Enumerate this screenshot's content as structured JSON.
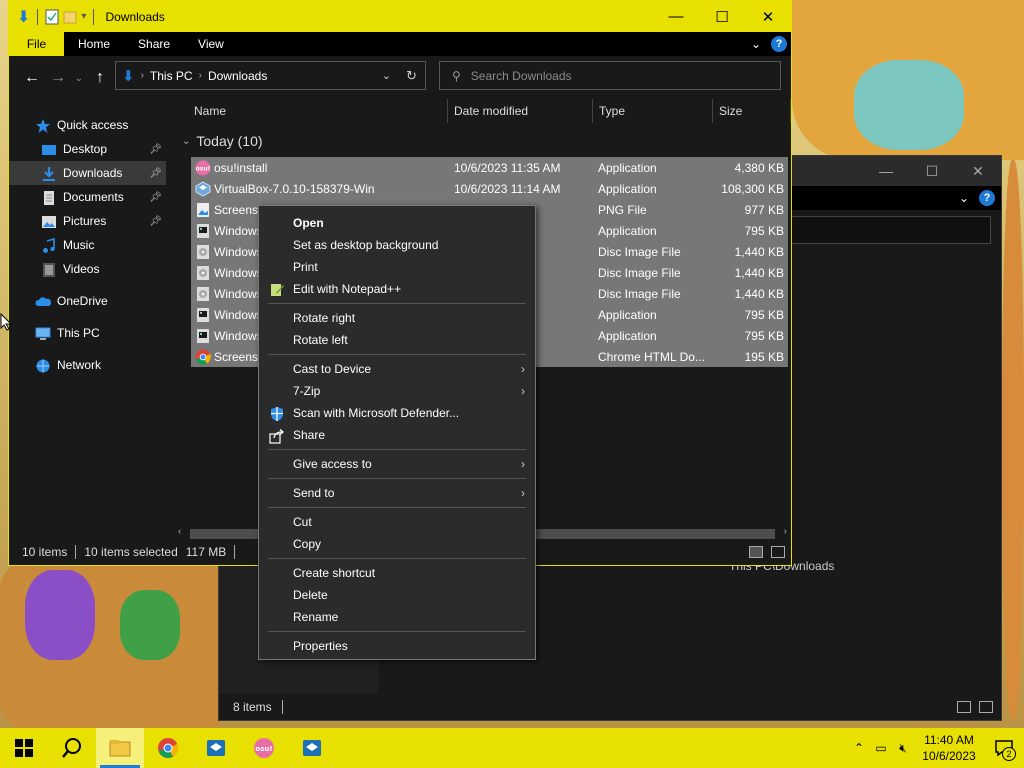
{
  "window": {
    "title": "Downloads",
    "ribbon_tabs": [
      "File",
      "Home",
      "Share",
      "View"
    ]
  },
  "address": {
    "crumbs": [
      "This PC",
      "Downloads"
    ]
  },
  "search": {
    "placeholder": "Search Downloads"
  },
  "sidebar": {
    "items": [
      {
        "label": "Quick access",
        "icon": "star-icon",
        "pinned": false
      },
      {
        "label": "Desktop",
        "icon": "desktop-folder-icon",
        "pinned": true
      },
      {
        "label": "Downloads",
        "icon": "download-folder-icon",
        "pinned": true
      },
      {
        "label": "Documents",
        "icon": "documents-folder-icon",
        "pinned": true
      },
      {
        "label": "Pictures",
        "icon": "pictures-folder-icon",
        "pinned": true
      },
      {
        "label": "Music",
        "icon": "music-folder-icon",
        "pinned": false
      },
      {
        "label": "Videos",
        "icon": "videos-folder-icon",
        "pinned": false
      },
      {
        "label": "OneDrive",
        "icon": "onedrive-icon",
        "pinned": false
      },
      {
        "label": "This PC",
        "icon": "computer-icon",
        "pinned": false
      },
      {
        "label": "Network",
        "icon": "network-icon",
        "pinned": false
      }
    ]
  },
  "columns": {
    "name": "Name",
    "date": "Date modified",
    "type": "Type",
    "size": "Size"
  },
  "group_label": "Today (10)",
  "files": [
    {
      "name": "osu!install",
      "date": "10/6/2023 11:35 AM",
      "type": "Application",
      "size": "4,380 KB",
      "icon": "osu-icon"
    },
    {
      "name": "VirtualBox-7.0.10-158379-Win",
      "date": "10/6/2023 11:14 AM",
      "type": "Application",
      "size": "108,300 KB",
      "icon": "virtualbox-icon"
    },
    {
      "name": "Screensho",
      "date": "",
      "type": "PNG File",
      "size": "977 KB",
      "icon": "image-file-icon"
    },
    {
      "name": "Windows",
      "date": "AM",
      "type": "Application",
      "size": "795 KB",
      "icon": "app-file-icon"
    },
    {
      "name": "Windows",
      "date": "AM",
      "type": "Disc Image File",
      "size": "1,440 KB",
      "icon": "disc-image-icon"
    },
    {
      "name": "Windows",
      "date": "AM",
      "type": "Disc Image File",
      "size": "1,440 KB",
      "icon": "disc-image-icon"
    },
    {
      "name": "Windows",
      "date": "AM",
      "type": "Disc Image File",
      "size": "1,440 KB",
      "icon": "disc-image-icon"
    },
    {
      "name": "Windows",
      "date": "AM",
      "type": "Application",
      "size": "795 KB",
      "icon": "app-file-icon"
    },
    {
      "name": "Windows",
      "date": "AM",
      "type": "Application",
      "size": "795 KB",
      "icon": "app-file-icon"
    },
    {
      "name": "Screensho",
      "date": "AM",
      "type": "Chrome HTML Do...",
      "size": "195 KB",
      "icon": "chrome-icon"
    }
  ],
  "status": {
    "count": "10 items",
    "selected": "10 items selected",
    "size": "117 MB"
  },
  "context_menu": {
    "items": [
      {
        "label": "Open",
        "bold": true,
        "submenu": false,
        "icon": ""
      },
      {
        "label": "Set as desktop background",
        "bold": false,
        "submenu": false,
        "icon": ""
      },
      {
        "label": "Print",
        "bold": false,
        "submenu": false,
        "icon": ""
      },
      {
        "label": "Edit with Notepad++",
        "bold": false,
        "submenu": false,
        "icon": "notepadpp-icon"
      },
      {
        "sep": true
      },
      {
        "label": "Rotate right",
        "bold": false,
        "submenu": false,
        "icon": ""
      },
      {
        "label": "Rotate left",
        "bold": false,
        "submenu": false,
        "icon": ""
      },
      {
        "sep": true
      },
      {
        "label": "Cast to Device",
        "bold": false,
        "submenu": true,
        "icon": ""
      },
      {
        "label": "7-Zip",
        "bold": false,
        "submenu": true,
        "icon": ""
      },
      {
        "label": "Scan with Microsoft Defender...",
        "bold": false,
        "submenu": false,
        "icon": "defender-shield-icon"
      },
      {
        "label": "Share",
        "bold": false,
        "submenu": false,
        "icon": "share-icon"
      },
      {
        "sep": true
      },
      {
        "label": "Give access to",
        "bold": false,
        "submenu": true,
        "icon": ""
      },
      {
        "sep": true
      },
      {
        "label": "Send to",
        "bold": false,
        "submenu": true,
        "icon": ""
      },
      {
        "sep": true
      },
      {
        "label": "Cut",
        "bold": false,
        "submenu": false,
        "icon": ""
      },
      {
        "label": "Copy",
        "bold": false,
        "submenu": false,
        "icon": ""
      },
      {
        "sep": true
      },
      {
        "label": "Create shortcut",
        "bold": false,
        "submenu": false,
        "icon": ""
      },
      {
        "label": "Delete",
        "bold": false,
        "submenu": false,
        "icon": ""
      },
      {
        "label": "Rename",
        "bold": false,
        "submenu": false,
        "icon": ""
      },
      {
        "sep": true
      },
      {
        "label": "Properties",
        "bold": false,
        "submenu": false,
        "icon": ""
      }
    ]
  },
  "background_window": {
    "detail_line1": "ownloads",
    "detail_line2": "This PC\\Downloads",
    "status_count": "8 items"
  },
  "taskbar": {
    "apps": [
      "start-icon",
      "search-icon",
      "file-explorer-icon",
      "chrome-icon",
      "virtualbox-icon",
      "osu-icon",
      "virtualbox-icon"
    ],
    "time": "11:40 AM",
    "date": "10/6/2023",
    "notification_count": "2"
  },
  "colors": {
    "accent": "#e8e000",
    "selection": "#777777",
    "dark_bg": "#191919",
    "link_blue": "#1f7ad6"
  }
}
